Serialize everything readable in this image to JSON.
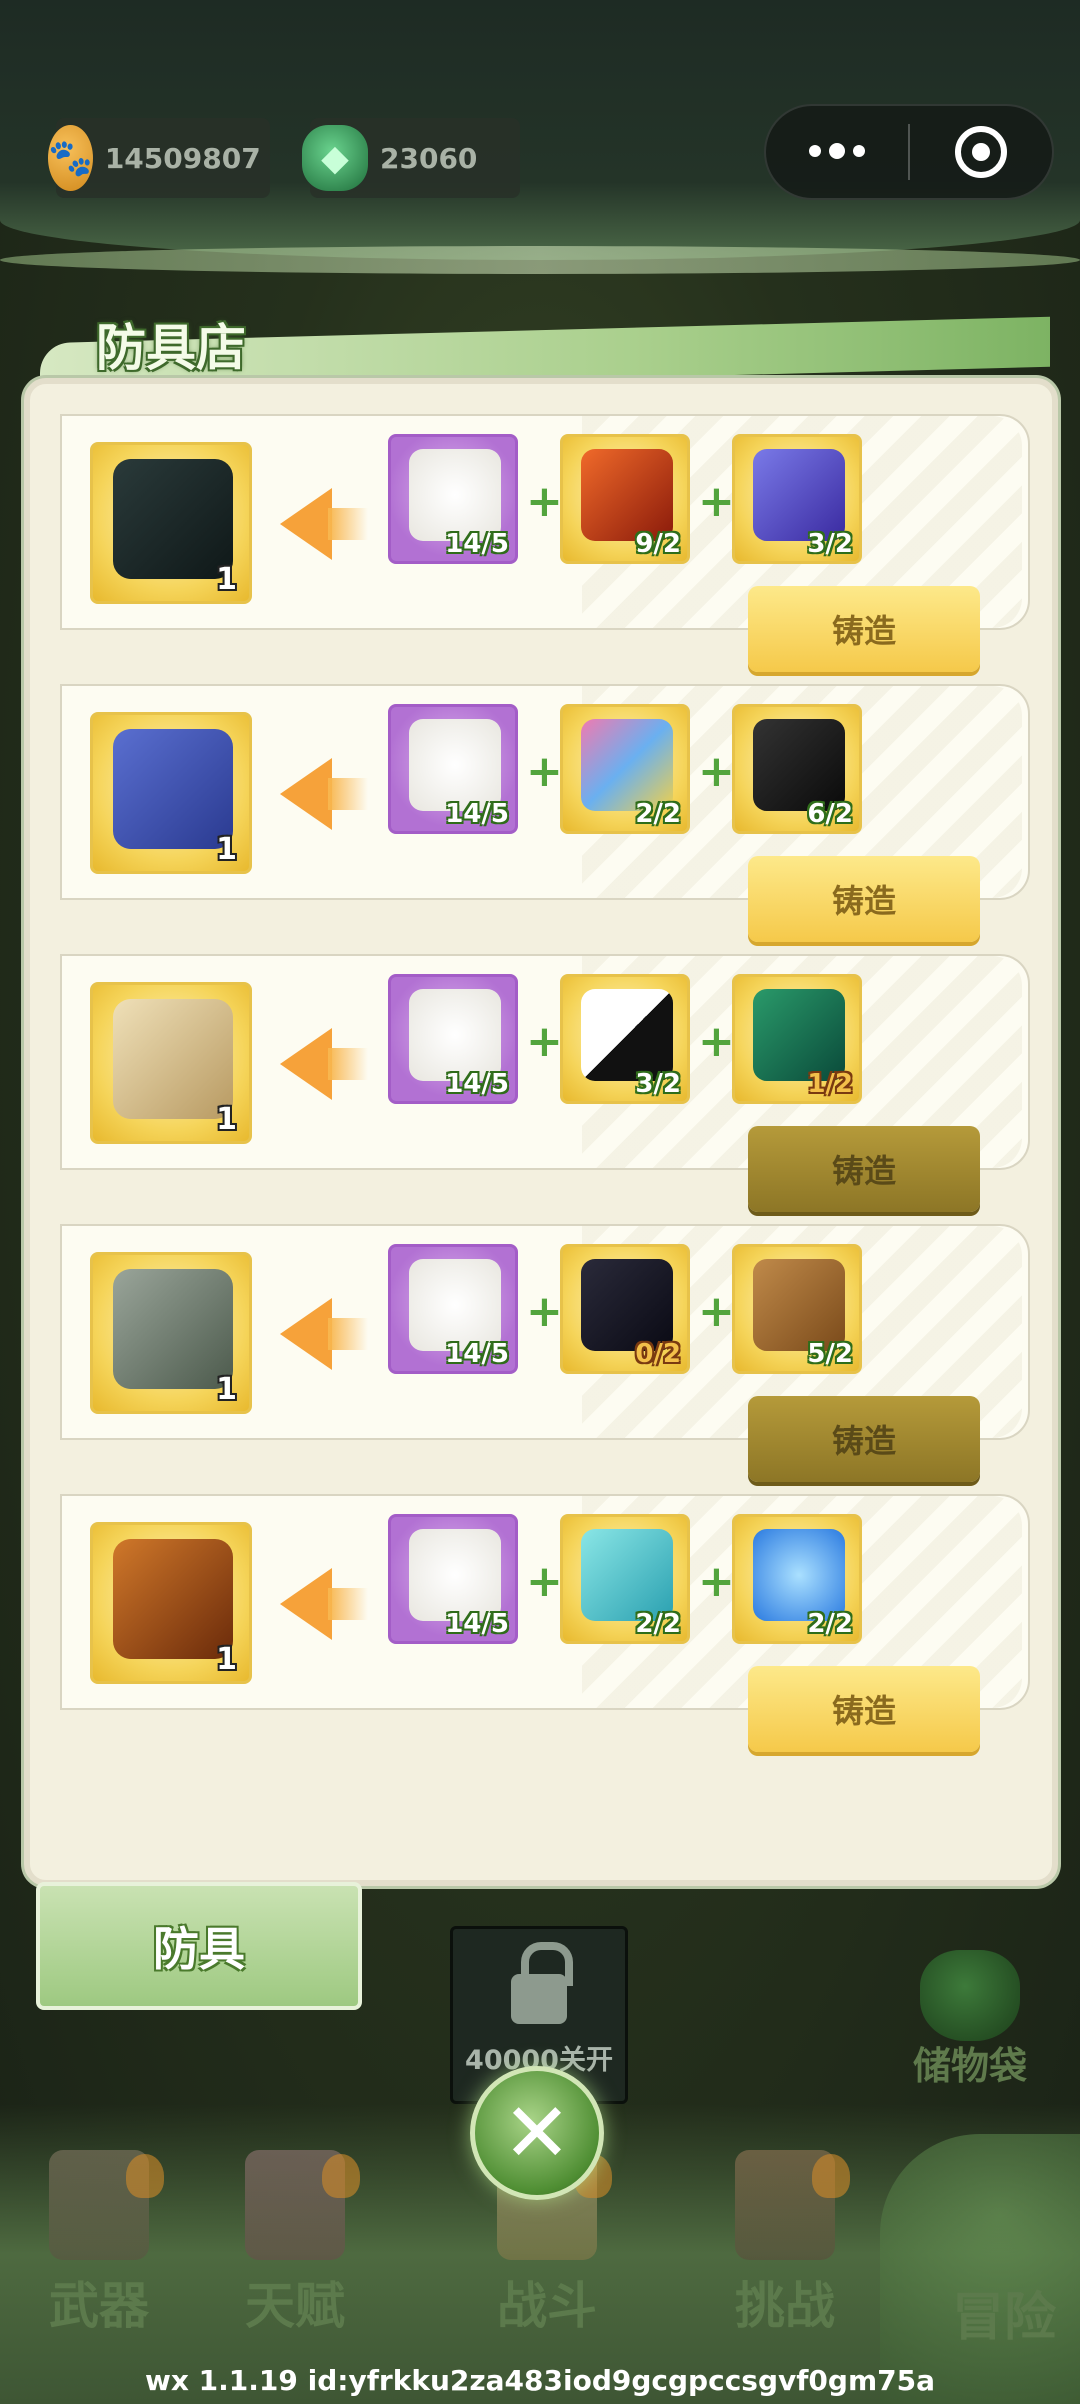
{
  "currency": {
    "coins": "14509807",
    "gems": "23060"
  },
  "panel": {
    "title": "防具店",
    "forge_label": "铸造"
  },
  "recipes": [
    {
      "result_name": "shield",
      "result_count": "1",
      "materials": [
        {
          "icon": "cotton-icon",
          "need": "14/5",
          "enough": true
        },
        {
          "icon": "fire-crystal-icon",
          "need": "9/2",
          "enough": true
        },
        {
          "icon": "lightning-log-icon",
          "need": "3/2",
          "enough": true
        }
      ],
      "forge_enabled": true
    },
    {
      "result_name": "boots",
      "result_count": "1",
      "materials": [
        {
          "icon": "cotton-icon",
          "need": "14/5",
          "enough": true
        },
        {
          "icon": "butterfly-wing-icon",
          "need": "2/2",
          "enough": true
        },
        {
          "icon": "black-cloth-icon",
          "need": "6/2",
          "enough": true
        }
      ],
      "forge_enabled": true
    },
    {
      "result_name": "robe",
      "result_count": "1",
      "materials": [
        {
          "icon": "cotton-icon",
          "need": "14/5",
          "enough": true
        },
        {
          "icon": "yin-yang-cloth-icon",
          "need": "3/2",
          "enough": true
        },
        {
          "icon": "jade-silk-icon",
          "need": "1/2",
          "enough": false
        }
      ],
      "forge_enabled": false
    },
    {
      "result_name": "stone-armor",
      "result_count": "1",
      "materials": [
        {
          "icon": "cotton-icon",
          "need": "14/5",
          "enough": true
        },
        {
          "icon": "dark-crystal-icon",
          "need": "0/2",
          "enough": false
        },
        {
          "icon": "fire-rope-icon",
          "need": "5/2",
          "enough": true
        }
      ],
      "forge_enabled": false
    },
    {
      "result_name": "flame-armor",
      "result_count": "1",
      "materials": [
        {
          "icon": "cotton-icon",
          "need": "14/5",
          "enough": true
        },
        {
          "icon": "ice-log-icon",
          "need": "2/2",
          "enough": true
        },
        {
          "icon": "water-orb-icon",
          "need": "2/2",
          "enough": true
        }
      ],
      "forge_enabled": true
    }
  ],
  "below": {
    "armor_tab": "防具",
    "locked_text": "40000关开",
    "bag_label": "储物袋"
  },
  "nav": {
    "weapons": "武器",
    "talent": "天赋",
    "battle": "战斗",
    "challenge": "挑战",
    "adventure": "冒险"
  },
  "footer": {
    "version": "wx  1.1.19 id:yfrkku2za483iod9gcgpccsgvf0gm75a"
  },
  "colors": {
    "forge_active": "#f5c94a",
    "forge_disabled": "#8d7626",
    "material_purple": "#b271d3",
    "material_yellow": "#f5d459",
    "count_ok": "#2f6d1a",
    "count_short": "#7a3a10"
  }
}
